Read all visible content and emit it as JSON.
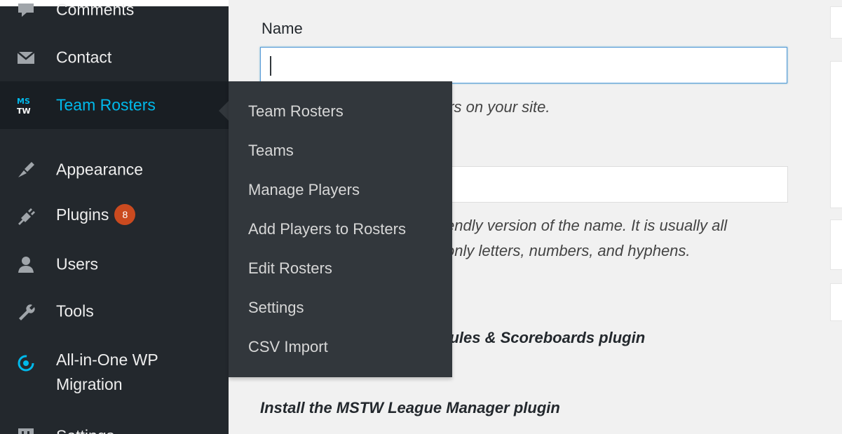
{
  "sidebar": {
    "items": [
      {
        "label": "Comments",
        "icon": "comment-icon"
      },
      {
        "label": "Contact",
        "icon": "envelope-icon"
      },
      {
        "label": "Team Rosters",
        "icon": "mstw-logo-icon"
      },
      {
        "label": "Appearance",
        "icon": "paintbrush-icon"
      },
      {
        "label": "Plugins",
        "icon": "plug-icon",
        "badge": "8"
      },
      {
        "label": "Users",
        "icon": "user-icon"
      },
      {
        "label": "Tools",
        "icon": "wrench-icon"
      },
      {
        "label": "All-in-One WP Migration",
        "icon": "migration-icon"
      },
      {
        "label": "Settings",
        "icon": "settings-icon"
      }
    ]
  },
  "flyout": {
    "items": [
      {
        "label": "Team Rosters"
      },
      {
        "label": "Teams"
      },
      {
        "label": "Manage Players"
      },
      {
        "label": "Add Players to Rosters"
      },
      {
        "label": "Edit Rosters"
      },
      {
        "label": "Settings"
      },
      {
        "label": "CSV Import"
      }
    ]
  },
  "form": {
    "name_label": "Name",
    "name_value": "",
    "name_desc": "ars on your site.",
    "slug_value": "",
    "slug_desc_1": "endly version of the name. It is usually all",
    "slug_desc_2": "only letters, numbers, and hyphens."
  },
  "notices": {
    "schedules": "dules & Scoreboards plugin",
    "league": "Install the MSTW League Manager plugin"
  },
  "colors": {
    "sidebar_bg": "#23282d",
    "flyout_bg": "#32373c",
    "active_text": "#00b9eb",
    "badge": "#ca4a1f"
  }
}
